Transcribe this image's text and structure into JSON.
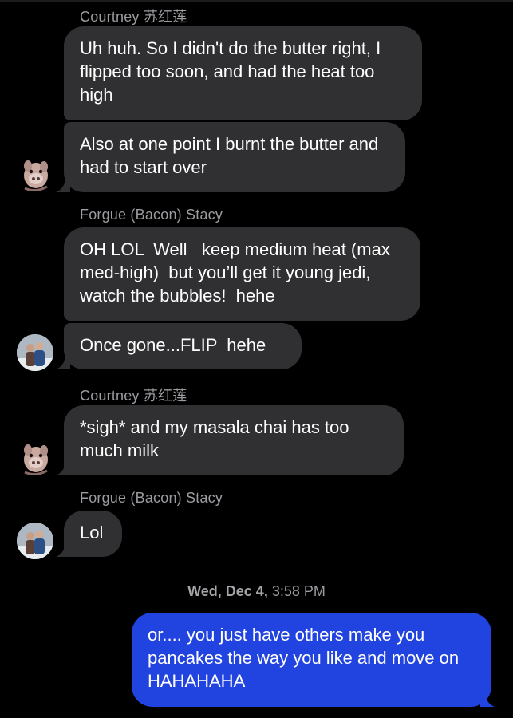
{
  "conversation": {
    "messages": [
      {
        "sender": "Courtney 苏红莲",
        "text": "Uh huh. So I didn't do the butter right, I flipped too soon, and had the heat too high"
      },
      {
        "text": "Also at one point I burnt the butter and had to start over"
      },
      {
        "sender": "Forgue (Bacon) Stacy",
        "text": "OH LOL  Well   keep medium heat (max med-high)  but you’ll get it young jedi, watch the bubbles!  hehe"
      },
      {
        "text": "Once gone...FLIP  hehe"
      },
      {
        "sender": "Courtney 苏红莲",
        "text": "*sigh* and my masala chai has too much milk"
      },
      {
        "sender": "Forgue (Bacon) Stacy",
        "text": "Lol"
      }
    ],
    "timestamp": {
      "day": "Wed, Dec 4,",
      "time": "3:58 PM"
    },
    "outgoing": {
      "text": "or.... you just have others make you pancakes the way you like and move on HAHAHAHA"
    }
  },
  "colors": {
    "background": "#000000",
    "incoming_bubble": "#303032",
    "outgoing_bubble": "#2143e0",
    "meta_text": "#9b9ba0"
  },
  "icons": {
    "avatar_courtney": "pig-avatar",
    "avatar_stacy": "couple-photo-avatar"
  }
}
